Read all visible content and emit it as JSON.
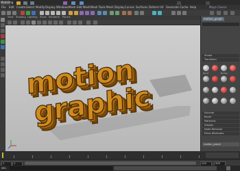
{
  "mode_menu": {
    "label": "Modeling"
  },
  "menus": [
    "File",
    "Edit",
    "Create",
    "Select",
    "Modify",
    "Display",
    "Windows",
    "Mesh",
    "Edit Mesh",
    "Mesh Tools",
    "Mesh Display",
    "Curves",
    "Surfaces",
    "Deform",
    "UV",
    "Generate",
    "Cache",
    "Help"
  ],
  "workspace": {
    "label": "Maya Classic"
  },
  "panel_menu": [
    "View",
    "Shading",
    "Lighting",
    "Show",
    "Renderer",
    "Panels"
  ],
  "attribute_editor": {
    "tab_label": "motion_graph",
    "sections": [
      "Shape",
      "Transform",
      "Extrude",
      "Bevel",
      "Materials",
      "Display",
      "Node Behavior",
      "Extra Attributes"
    ],
    "shelf_labels": [
      "Bevel",
      "Extrude",
      "Bridge",
      "Merge",
      "Fill",
      "Split",
      "Cut",
      "Knife",
      "Loop"
    ]
  },
  "viewport_text": [
    "motion",
    "graphic"
  ],
  "colors": {
    "extrude_orange": "#d08a1e",
    "viewport_bg": "#c6c6c6"
  },
  "timeline": {
    "start": "1",
    "end": "120"
  },
  "range": {
    "start": "1",
    "end": "200"
  },
  "command": {
    "label": "MEL"
  }
}
